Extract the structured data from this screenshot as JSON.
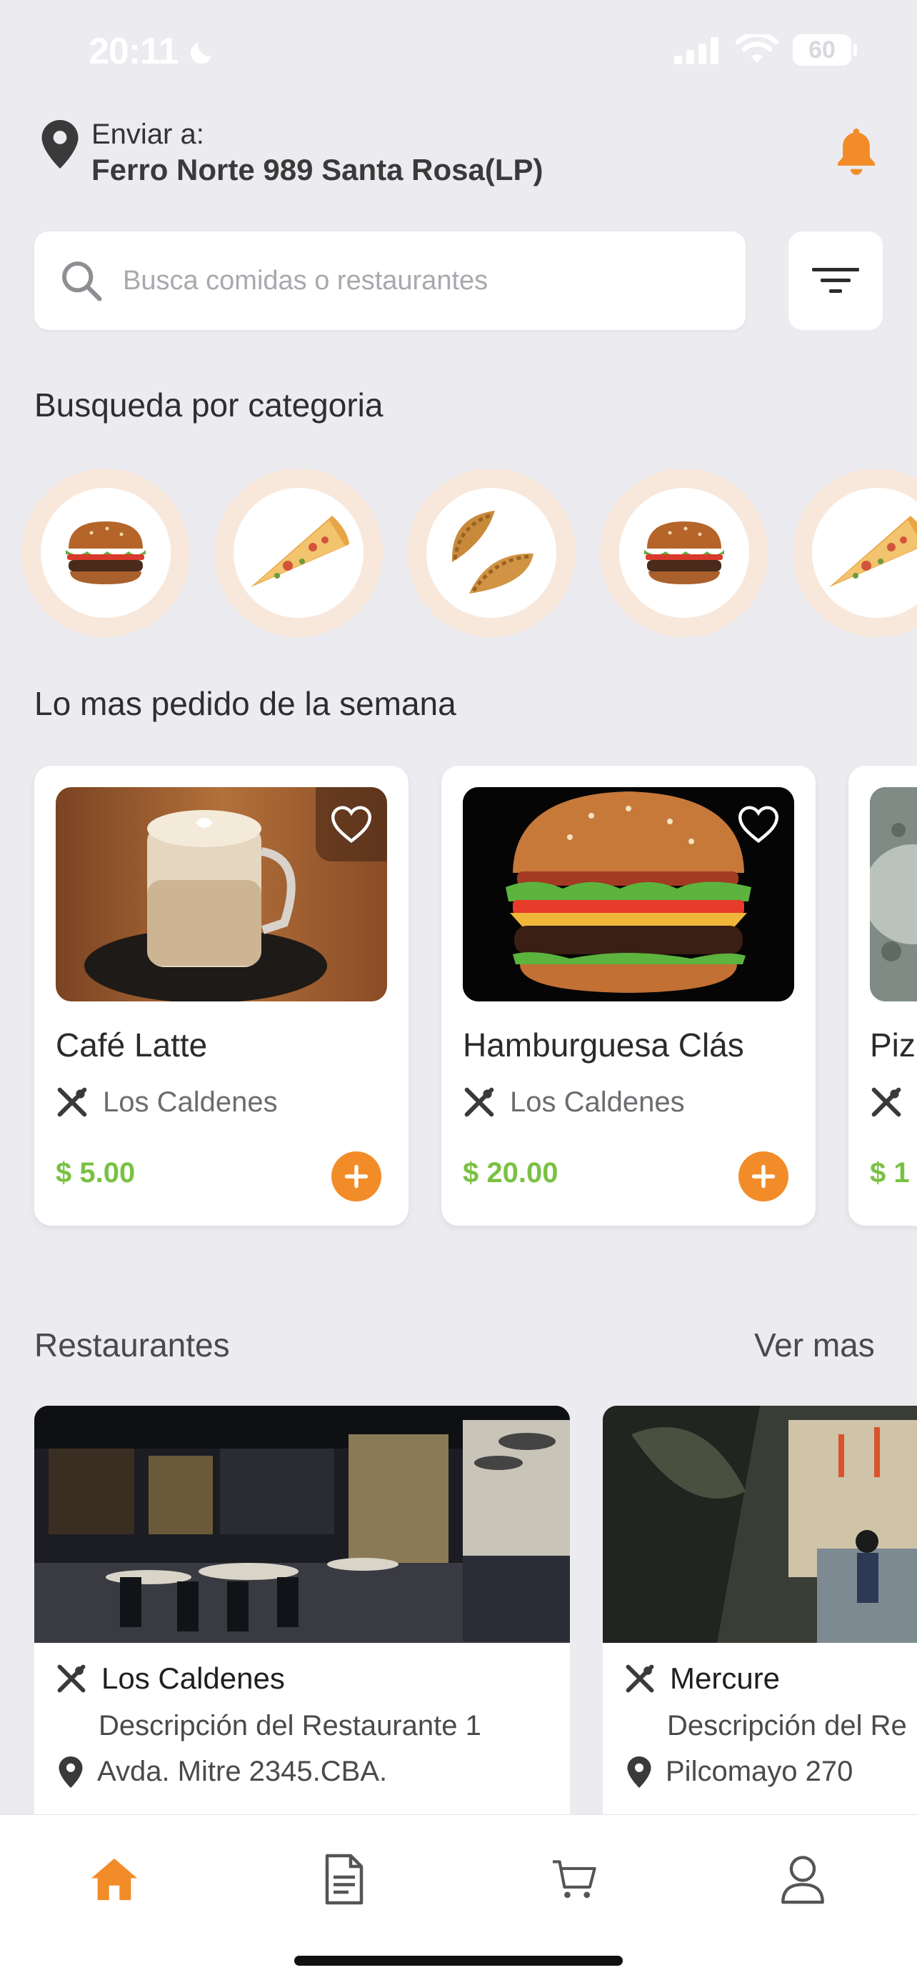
{
  "status_bar": {
    "time": "20:11",
    "battery": "60"
  },
  "header": {
    "deliver_label": "Enviar a:",
    "address": "Ferro Norte 989 Santa Rosa(LP)"
  },
  "search": {
    "placeholder": "Busca comidas o restaurantes"
  },
  "categories": {
    "title": "Busqueda por categoria",
    "items": [
      "hamburger-icon",
      "pizza-icon",
      "empanada-icon",
      "hamburger-icon",
      "pizza-icon"
    ]
  },
  "popular": {
    "title": "Lo mas pedido de la semana",
    "items": [
      {
        "name": "Café Latte",
        "restaurant": "Los Caldenes",
        "price": "$ 5.00"
      },
      {
        "name": "Hamburguesa Clás",
        "restaurant": "Los Caldenes",
        "price": "$ 20.00"
      },
      {
        "name": "Piz",
        "restaurant": "",
        "price": "$ 1"
      }
    ]
  },
  "restaurants": {
    "title": "Restaurantes",
    "see_more": "Ver mas",
    "items": [
      {
        "name": "Los Caldenes",
        "description": "Descripción del Restaurante 1",
        "address": "Avda. Mitre 2345.CBA."
      },
      {
        "name": "Mercure",
        "description": "Descripción del Re",
        "address": "Pilcomayo 270"
      }
    ]
  },
  "bottom_nav": [
    "home-icon",
    "orders-icon",
    "cart-icon",
    "profile-icon"
  ],
  "colors": {
    "accent": "#f28c28",
    "price": "#7ac143",
    "background": "#ebebf0"
  }
}
